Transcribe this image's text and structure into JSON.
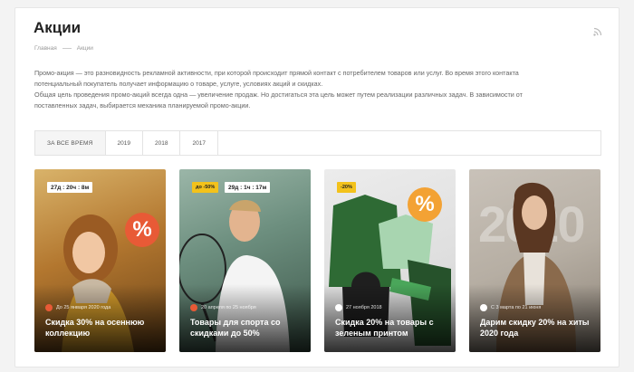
{
  "page": {
    "title": "Акции"
  },
  "breadcrumbs": {
    "home": "Главная",
    "current": "Акции"
  },
  "description": {
    "line1": "Промо-акция — это разновидность рекламной активности, при которой происходит прямой контакт с потребителем товаров или услуг. Во время этого контакта",
    "line2": "потенциальный покупатель получает информацию о товаре, услуге, условиях акций и скидках.",
    "line3": "Общая цель проведения промо-акций всегда одна — увеличение продаж. Но достигаться эта цель может путем реализации различных задач. В зависимости от",
    "line4": "поставленных задач, выбирается механика планируемой промо-акции."
  },
  "tabs": [
    "За все время",
    "2019",
    "2018",
    "2017"
  ],
  "cards": [
    {
      "timer": "27д : 20ч : 8м",
      "date": "До 25 января 2020 года",
      "title": "Скидка 30% на осеннюю коллекцию",
      "pct_icon": "%"
    },
    {
      "badge": "до -50%",
      "timer": "29д : 1ч : 17м",
      "date": "20 апреля по 25 ноября",
      "title": "Товары для спорта со скидками до 50%"
    },
    {
      "badge": "-20%",
      "date": "27 ноября 2018",
      "title": "Скидка 20% на товары с зеленым принтом",
      "pct_icon": "%"
    },
    {
      "date": "С 3 марта по 21 июня",
      "title": "Дарим скидку 20% на хиты 2020 года",
      "bg_text": "2020"
    }
  ],
  "colors": {
    "accent": "#e85a36",
    "badge": "#f3c21b"
  }
}
